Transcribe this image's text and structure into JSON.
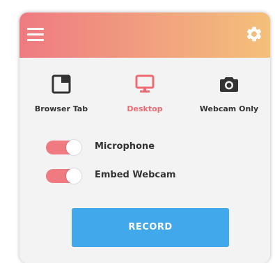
{
  "header": {
    "menu_icon": "hamburger-menu-icon",
    "settings_icon": "gear-icon",
    "gradient_start": "#ef7a82",
    "gradient_end": "#f4c07a"
  },
  "modes": [
    {
      "label": "Browser Tab",
      "icon": "browser-tab-icon",
      "active": false
    },
    {
      "label": "Desktop",
      "icon": "desktop-monitor-icon",
      "active": true
    },
    {
      "label": "Webcam Only",
      "icon": "camera-icon",
      "active": false
    }
  ],
  "toggles": [
    {
      "label": "Microphone",
      "on": true
    },
    {
      "label": "Embed Webcam",
      "on": true
    }
  ],
  "record_button": {
    "label": "RECORD",
    "color": "#42a8ec"
  },
  "colors": {
    "accent": "#ef6b72",
    "toggle_on": "#ef7a80",
    "panel_bg": "#f3f3f3",
    "text": "#333333"
  }
}
